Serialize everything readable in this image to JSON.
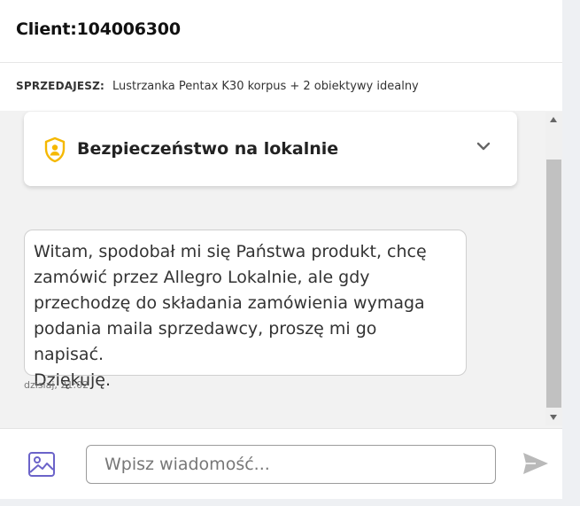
{
  "header": {
    "client_title": "Client:104006300"
  },
  "seller": {
    "label": "SPRZEDAJESZ:",
    "item": "Lustrzanka Pentax K30 korpus + 2 obiektywy idealny"
  },
  "safety": {
    "title": "Bezpieczeństwo na lokalnie",
    "icon": "shield-user-icon",
    "accent": "#f5b800"
  },
  "messages": [
    {
      "text": "Witam, spodobał mi się Państwa produkt, chcę\nzamówić przez Allegro Lokalnie, ale gdy\nprzechodzę do składania zamówienia wymaga\npodania maila sprzedawcy, proszę mi go napisać.\nDziękuję.",
      "timestamp": "dzisiaj, 21:02"
    }
  ],
  "composer": {
    "placeholder": "Wpisz wiadomość...",
    "value": "",
    "image_icon": "image-icon",
    "send_icon": "send-icon",
    "accent": "#6b63c9"
  }
}
